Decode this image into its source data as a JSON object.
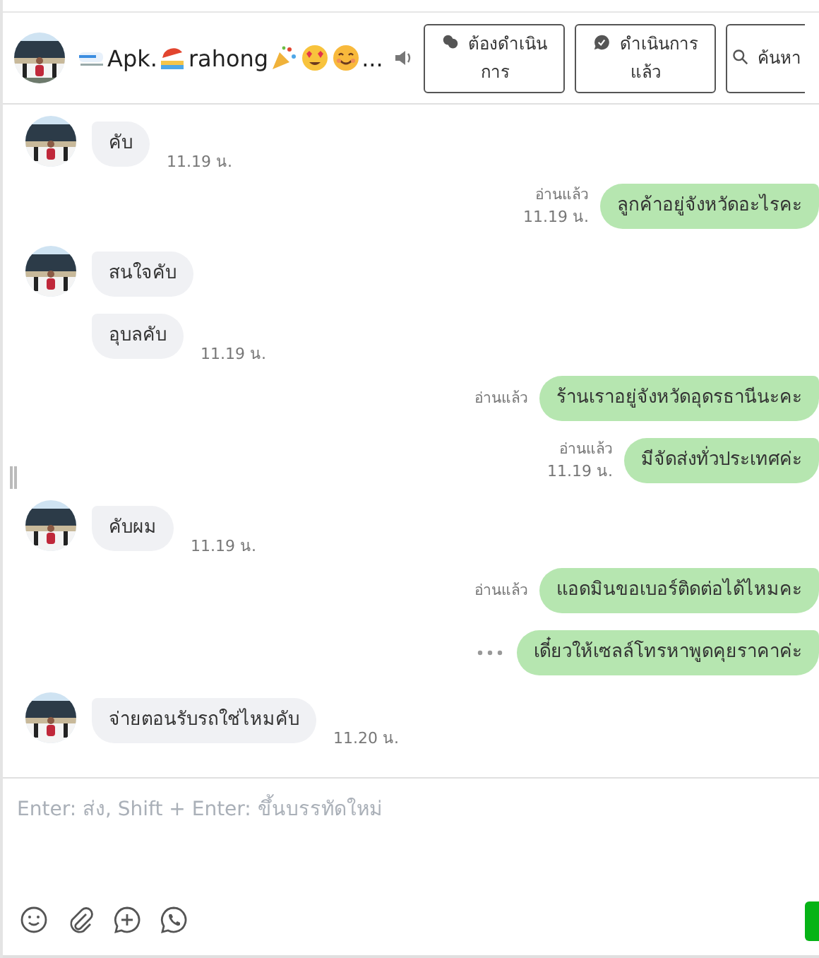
{
  "header": {
    "title": [
      "Apk.",
      "rahong",
      "..."
    ],
    "buttons": [
      {
        "kind": "pending",
        "label": "ต้องดำเนินการ"
      },
      {
        "kind": "done",
        "label": "ดำเนินการแล้ว"
      },
      {
        "kind": "search",
        "label": "ค้นหา"
      }
    ]
  },
  "messages": [
    {
      "kind": "in",
      "text": "คับ",
      "avatar": true,
      "time": "11.19 น."
    },
    {
      "kind": "out",
      "text": "ลูกค้าอยู่จังหวัดอะไรคะ",
      "read": "อ่านแล้ว",
      "time": "11.19 น.",
      "more": false
    },
    {
      "kind": "in",
      "text": "สนใจคับ",
      "avatar": true
    },
    {
      "kind": "in",
      "text": "อุบลคับ",
      "avatar": false,
      "time": "11.19 น."
    },
    {
      "kind": "out",
      "text": "ร้านเราอยู่จังหวัดอุดรธานีนะคะ",
      "read": "อ่านแล้ว",
      "more": false
    },
    {
      "kind": "out",
      "text": "มีจัดส่งทั่วประเทศค่ะ",
      "read": "อ่านแล้ว",
      "time": "11.19 น.",
      "more": false
    },
    {
      "kind": "in",
      "text": "คับผม",
      "avatar": true,
      "time": "11.19 น."
    },
    {
      "kind": "out",
      "text": "แอดมินขอเบอร์ติดต่อได้ไหมคะ",
      "read": "อ่านแล้ว",
      "more": false
    },
    {
      "kind": "out",
      "text": "เดี๋ยวให้เซลล์โทรหาพูดคุยราคาค่ะ",
      "more": true
    },
    {
      "kind": "in",
      "text": "จ่ายตอนรับรถใช่ไหมคับ",
      "avatar": true,
      "time": "11.20 น."
    }
  ],
  "composer": {
    "placeholder": "Enter: ส่ง, Shift + Enter: ขึ้นบรรทัดใหม่"
  }
}
